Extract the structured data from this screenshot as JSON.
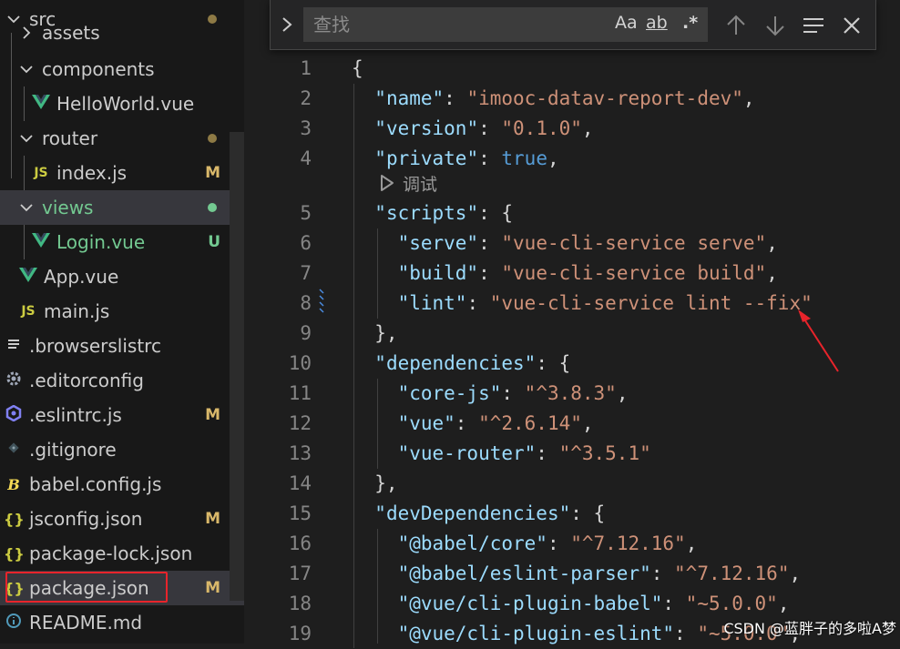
{
  "explorer": {
    "items": [
      {
        "label": "src",
        "kind": "folder-open",
        "status": "dot",
        "status_color": "#8e7a45"
      },
      {
        "label": "assets",
        "kind": "folder-collapsed"
      },
      {
        "label": "components",
        "kind": "folder-open"
      },
      {
        "label": "HelloWorld.vue",
        "kind": "vue"
      },
      {
        "label": "router",
        "kind": "folder-open",
        "status": "dot",
        "status_color": "#8e7a45"
      },
      {
        "label": "index.js",
        "kind": "js",
        "status": "M",
        "status_color": "#d9b86a"
      },
      {
        "label": "views",
        "kind": "folder-open",
        "status": "dot",
        "status_color": "#73c991",
        "highlight_color": "#73c991"
      },
      {
        "label": "Login.vue",
        "kind": "vue",
        "status": "U",
        "status_color": "#73c991",
        "highlight_color": "#73c991"
      },
      {
        "label": "App.vue",
        "kind": "vue"
      },
      {
        "label": "main.js",
        "kind": "js"
      },
      {
        "label": ".browserslistrc",
        "kind": "lines"
      },
      {
        "label": ".editorconfig",
        "kind": "gear"
      },
      {
        "label": ".eslintrc.js",
        "kind": "eslint",
        "status": "M",
        "status_color": "#d9b86a"
      },
      {
        "label": ".gitignore",
        "kind": "git"
      },
      {
        "label": "babel.config.js",
        "kind": "babel"
      },
      {
        "label": "jsconfig.json",
        "kind": "json",
        "status": "M",
        "status_color": "#d9b86a"
      },
      {
        "label": "package-lock.json",
        "kind": "json"
      },
      {
        "label": "package.json",
        "kind": "json",
        "status": "M",
        "status_color": "#d9b86a",
        "selected": true
      },
      {
        "label": "README.md",
        "kind": "info"
      }
    ],
    "icon_glyphs": {
      "js": "JS",
      "json": "{}"
    },
    "colors": {
      "vue": "#41b883",
      "js": "#cbcb41",
      "json": "#cbcb41",
      "eslint": "#8080f2",
      "highlight_box": "#e8242b"
    }
  },
  "find": {
    "placeholder": "查找",
    "match_case": "Aa",
    "whole_word": "ab",
    "regex": ".*"
  },
  "codelens": {
    "label": "调试"
  },
  "code": {
    "lines": [
      {
        "n": "1",
        "tokens": [
          [
            "p",
            "{"
          ]
        ]
      },
      {
        "n": "2",
        "tokens": [
          [
            "p",
            "  "
          ],
          [
            "k",
            "\"name\""
          ],
          [
            "p",
            ": "
          ],
          [
            "s",
            "\"imooc-datav-report-dev\""
          ],
          [
            "p",
            ","
          ]
        ]
      },
      {
        "n": "3",
        "tokens": [
          [
            "p",
            "  "
          ],
          [
            "k",
            "\"version\""
          ],
          [
            "p",
            ": "
          ],
          [
            "s",
            "\"0.1.0\""
          ],
          [
            "p",
            ","
          ]
        ]
      },
      {
        "n": "4",
        "tokens": [
          [
            "p",
            "  "
          ],
          [
            "k",
            "\"private\""
          ],
          [
            "p",
            ": "
          ],
          [
            "b",
            "true"
          ],
          [
            "p",
            ","
          ]
        ]
      },
      {
        "n": "5",
        "tokens": [
          [
            "p",
            "  "
          ],
          [
            "k",
            "\"scripts\""
          ],
          [
            "p",
            ": {"
          ]
        ]
      },
      {
        "n": "6",
        "tokens": [
          [
            "p",
            "    "
          ],
          [
            "k",
            "\"serve\""
          ],
          [
            "p",
            ": "
          ],
          [
            "s",
            "\"vue-cli-service serve\""
          ],
          [
            "p",
            ","
          ]
        ]
      },
      {
        "n": "7",
        "tokens": [
          [
            "p",
            "    "
          ],
          [
            "k",
            "\"build\""
          ],
          [
            "p",
            ": "
          ],
          [
            "s",
            "\"vue-cli-service build\""
          ],
          [
            "p",
            ","
          ]
        ]
      },
      {
        "n": "8",
        "tokens": [
          [
            "p",
            "    "
          ],
          [
            "k",
            "\"lint\""
          ],
          [
            "p",
            ": "
          ],
          [
            "s",
            "\"vue-cli-service lint --fix\""
          ]
        ]
      },
      {
        "n": "9",
        "tokens": [
          [
            "p",
            "  },"
          ]
        ]
      },
      {
        "n": "10",
        "tokens": [
          [
            "p",
            "  "
          ],
          [
            "k",
            "\"dependencies\""
          ],
          [
            "p",
            ": {"
          ]
        ]
      },
      {
        "n": "11",
        "tokens": [
          [
            "p",
            "    "
          ],
          [
            "k",
            "\"core-js\""
          ],
          [
            "p",
            ": "
          ],
          [
            "s",
            "\"^3.8.3\""
          ],
          [
            "p",
            ","
          ]
        ]
      },
      {
        "n": "12",
        "tokens": [
          [
            "p",
            "    "
          ],
          [
            "k",
            "\"vue\""
          ],
          [
            "p",
            ": "
          ],
          [
            "s",
            "\"^2.6.14\""
          ],
          [
            "p",
            ","
          ]
        ]
      },
      {
        "n": "13",
        "tokens": [
          [
            "p",
            "    "
          ],
          [
            "k",
            "\"vue-router\""
          ],
          [
            "p",
            ": "
          ],
          [
            "s",
            "\"^3.5.1\""
          ]
        ]
      },
      {
        "n": "14",
        "tokens": [
          [
            "p",
            "  },"
          ]
        ]
      },
      {
        "n": "15",
        "tokens": [
          [
            "p",
            "  "
          ],
          [
            "k",
            "\"devDependencies\""
          ],
          [
            "p",
            ": {"
          ]
        ]
      },
      {
        "n": "16",
        "tokens": [
          [
            "p",
            "    "
          ],
          [
            "k",
            "\"@babel/core\""
          ],
          [
            "p",
            ": "
          ],
          [
            "s",
            "\"^7.12.16\""
          ],
          [
            "p",
            ","
          ]
        ]
      },
      {
        "n": "17",
        "tokens": [
          [
            "p",
            "    "
          ],
          [
            "k",
            "\"@babel/eslint-parser\""
          ],
          [
            "p",
            ": "
          ],
          [
            "s",
            "\"^7.12.16\""
          ],
          [
            "p",
            ","
          ]
        ]
      },
      {
        "n": "18",
        "tokens": [
          [
            "p",
            "    "
          ],
          [
            "k",
            "\"@vue/cli-plugin-babel\""
          ],
          [
            "p",
            ": "
          ],
          [
            "s",
            "\"~5.0.0\""
          ],
          [
            "p",
            ","
          ]
        ]
      },
      {
        "n": "19",
        "tokens": [
          [
            "p",
            "    "
          ],
          [
            "k",
            "\"@vue/cli-plugin-eslint\""
          ],
          [
            "p",
            ": "
          ],
          [
            "s",
            "\"~5.0.0\""
          ],
          [
            "p",
            ","
          ]
        ]
      }
    ],
    "colors": {
      "k": "#9cdcfe",
      "s": "#ce9178",
      "b": "#569cd6",
      "p": "#d4d4d4",
      "line_number": "#858585",
      "annotation_arrow": "#e8242b"
    }
  },
  "watermark": "CSDN @蓝胖子的多啦A梦"
}
